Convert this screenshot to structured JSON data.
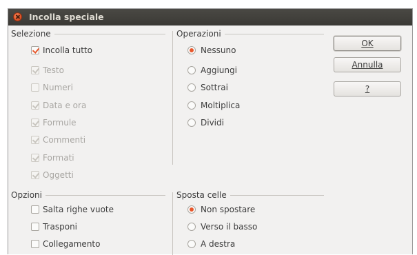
{
  "dialog": {
    "title": "Incolla speciale"
  },
  "selezione": {
    "heading": "Selezione",
    "items": [
      {
        "label": "Incolla tutto",
        "checked": true,
        "enabled": true
      },
      {
        "label": "Testo",
        "checked": true,
        "enabled": false
      },
      {
        "label": "Numeri",
        "checked": false,
        "enabled": false
      },
      {
        "label": "Data e ora",
        "checked": true,
        "enabled": false
      },
      {
        "label": "Formule",
        "checked": true,
        "enabled": false
      },
      {
        "label": "Commenti",
        "checked": true,
        "enabled": false
      },
      {
        "label": "Formati",
        "checked": true,
        "enabled": false
      },
      {
        "label": "Oggetti",
        "checked": true,
        "enabled": false
      }
    ]
  },
  "operazioni": {
    "heading": "Operazioni",
    "options": [
      {
        "label": "Nessuno",
        "selected": true
      },
      {
        "label": "Aggiungi",
        "selected": false
      },
      {
        "label": "Sottrai",
        "selected": false
      },
      {
        "label": "Moltiplica",
        "selected": false
      },
      {
        "label": "Dividi",
        "selected": false
      }
    ]
  },
  "opzioni": {
    "heading": "Opzioni",
    "items": [
      {
        "label": "Salta righe vuote",
        "checked": false
      },
      {
        "label": "Trasponi",
        "checked": false
      },
      {
        "label": "Collegamento",
        "checked": false
      }
    ]
  },
  "sposta_celle": {
    "heading": "Sposta celle",
    "options": [
      {
        "label": "Non spostare",
        "selected": true
      },
      {
        "label": "Verso il basso",
        "selected": false
      },
      {
        "label": "A destra",
        "selected": false
      }
    ]
  },
  "buttons": {
    "ok": "OK",
    "annulla": "Annulla",
    "help": "?"
  },
  "colors": {
    "accent": "#e8572b",
    "titlebar": "#3c3b37",
    "dialog_bg": "#f2f1f0"
  }
}
